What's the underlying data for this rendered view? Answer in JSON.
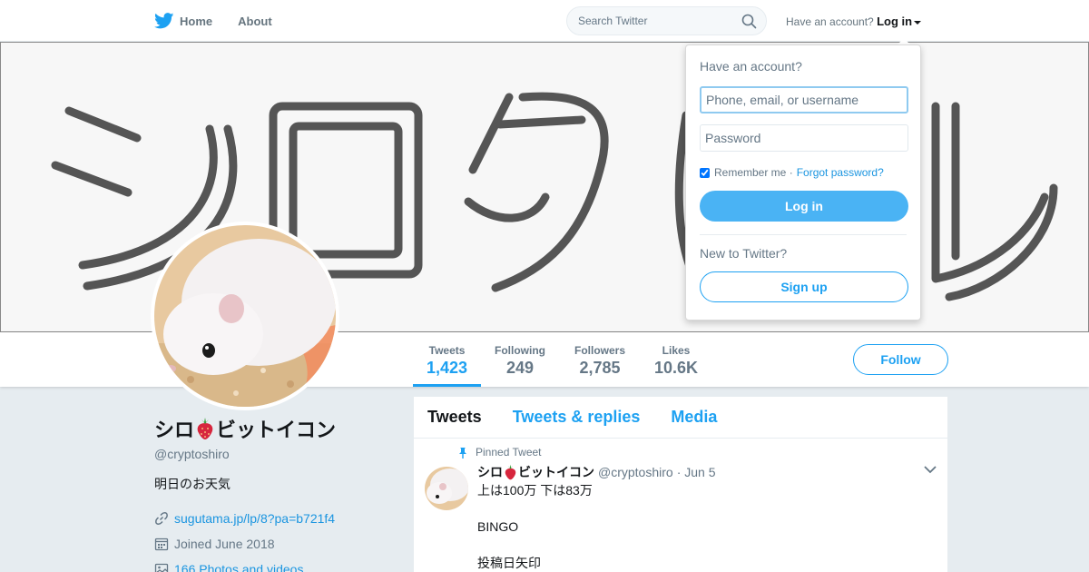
{
  "nav": {
    "home_label": "Home",
    "about_label": "About",
    "search_placeholder": "Search Twitter",
    "account_prompt": "Have an account?",
    "login_label": "Log in",
    "brand_color": "#1da1f2"
  },
  "profile": {
    "display_name_prefix": "シロ",
    "display_name_suffix": "ビットイコン",
    "handle": "@cryptoshiro",
    "bio": "明日のお天気",
    "website": "sugutama.jp/lp/8?pa=b721f4",
    "joined": "Joined June 2018",
    "media": "166 Photos and videos"
  },
  "stats": [
    {
      "label": "Tweets",
      "value": "1,423"
    },
    {
      "label": "Following",
      "value": "249"
    },
    {
      "label": "Followers",
      "value": "2,785"
    },
    {
      "label": "Likes",
      "value": "10.6K"
    }
  ],
  "follow_label": "Follow",
  "timeline": {
    "tabs": [
      "Tweets",
      "Tweets & replies",
      "Media"
    ],
    "pinned_label": "Pinned Tweet",
    "tweet": {
      "name_prefix": "シロ",
      "name_suffix": "ビットイコン",
      "handle": "@cryptoshiro",
      "date": "· Jun 5",
      "lines": [
        "上は100万 下は83万",
        "BINGO",
        "投稿日矢印"
      ]
    }
  },
  "login_dropdown": {
    "title": "Have an account?",
    "username_placeholder": "Phone, email, or username",
    "password_placeholder": "Password",
    "remember_label": "Remember me",
    "forgot_label": "Forgot password?",
    "login_button": "Log in",
    "new_prompt": "New to Twitter?",
    "signup_button": "Sign up"
  },
  "icons": [
    "twitter-bird-icon",
    "search-icon",
    "strawberry-icon",
    "link-icon",
    "calendar-icon",
    "image-icon",
    "pin-icon",
    "chevron-down-icon"
  ]
}
